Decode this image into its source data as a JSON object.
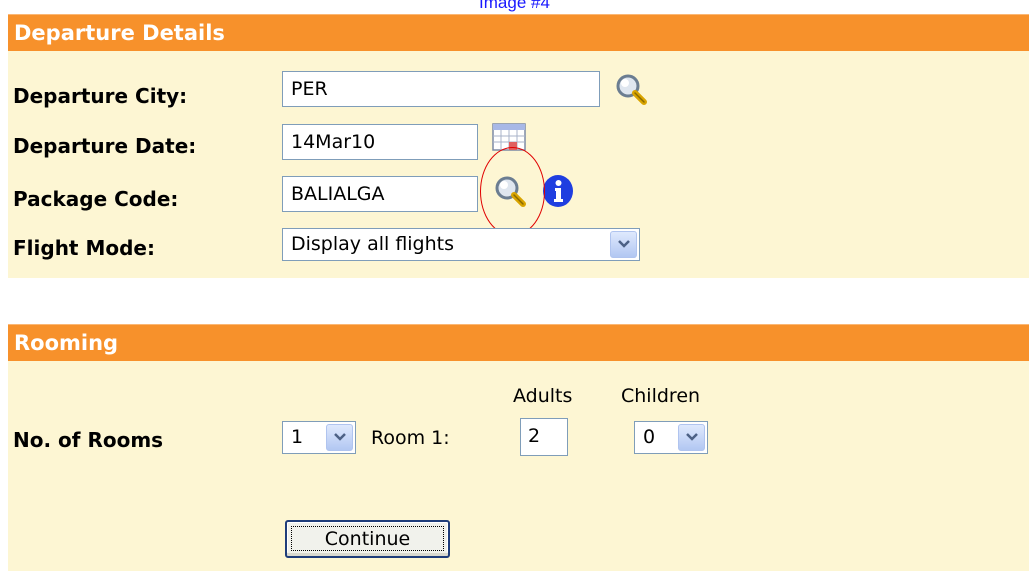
{
  "caption": "Image #4",
  "departure": {
    "header": "Departure Details",
    "city_label": "Departure City:",
    "city_value": "PER",
    "date_label": "Departure Date:",
    "date_value": "14Mar10",
    "package_label": "Package Code:",
    "package_value": "BALIALGA",
    "flight_mode_label": "Flight Mode:",
    "flight_mode_value": "Display all flights"
  },
  "rooming": {
    "header": "Rooming",
    "adults_header": "Adults",
    "children_header": "Children",
    "rooms_label": "No. of Rooms",
    "rooms_value": "1",
    "room1_label": "Room 1:",
    "adults_value": "2",
    "children_value": "0",
    "continue_label": "Continue"
  },
  "icons": [
    "magnifier-icon",
    "calendar-icon",
    "info-icon",
    "chevron-down-icon"
  ],
  "colors": {
    "header_bg": "#f7912b",
    "panel_bg": "#fdf6d3",
    "highlight_circle": "#e00000",
    "caption": "#1a1aff"
  }
}
